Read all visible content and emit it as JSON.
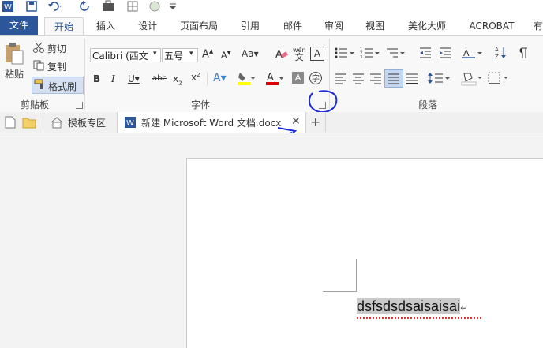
{
  "quick_access": {
    "word_icon": "word-icon",
    "save_icon": "save-icon",
    "undo_icon": "undo-icon",
    "redo_icon": "redo-icon"
  },
  "tabs": {
    "file": "文件",
    "home": "开始",
    "items": [
      "插入",
      "设计",
      "页面布局",
      "引用",
      "邮件",
      "审阅",
      "视图",
      "美化大师",
      "ACROBAT",
      "有"
    ]
  },
  "clipboard": {
    "paste": "粘贴",
    "cut": "剪切",
    "copy": "复制",
    "format_painter": "格式刷",
    "label": "剪贴板"
  },
  "font": {
    "family": "Calibri (西文",
    "size": "五号",
    "label": "字体",
    "phonetic": "wén",
    "phonetic_char": "文"
  },
  "paragraph": {
    "label": "段落"
  },
  "doc_tabs": {
    "template": "模板专区",
    "document": "新建 Microsoft Word 文档.docx"
  },
  "document": {
    "text": "dsfsdsdsaisaisai"
  },
  "colors": {
    "accent": "#2b579a",
    "annotation": "#1a2bd6",
    "highlight": "#ffff00",
    "font_color": "#e00000"
  }
}
